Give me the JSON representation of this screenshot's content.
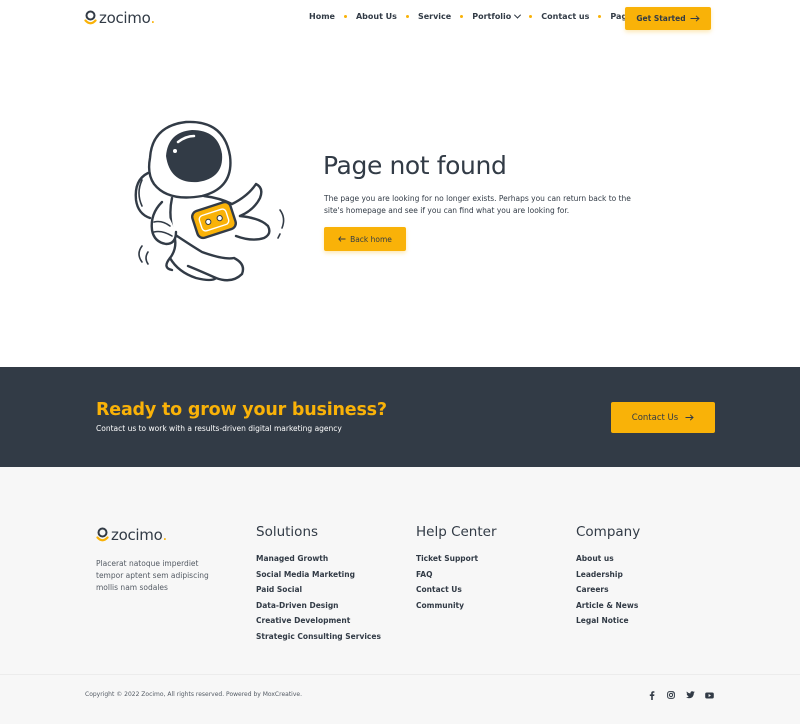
{
  "brand": {
    "name": "zocimo",
    "dot": ".",
    "accent": "#f9b208",
    "dark": "#323b46"
  },
  "nav": {
    "items": [
      {
        "label": "Home"
      },
      {
        "label": "About Us"
      },
      {
        "label": "Service"
      },
      {
        "label": "Portfolio"
      },
      {
        "label": "Contact us"
      },
      {
        "label": "Page"
      }
    ],
    "cta_label": "Get Started",
    "cta_icon": "arrow-right-icon"
  },
  "not_found": {
    "title": "Page not found",
    "text": "The page you are looking for no longer exists. Perhaps you can return back to the site's homepage and see if you can find what you are looking for.",
    "button_label": "Back home",
    "button_icon": "arrow-left-icon"
  },
  "cta": {
    "title": "Ready to grow your business?",
    "subtitle": "Contact us to work with a results-driven digital marketing agency",
    "button_label": "Contact Us",
    "button_icon": "arrow-right-icon"
  },
  "footer": {
    "description": "Placerat natoque imperdiet tempor aptent sem adipiscing mollis nam sodales",
    "columns": [
      {
        "title": "Solutions",
        "links": [
          "Managed Growth",
          "Social Media Marketing",
          "Paid Social",
          "Data-Driven Design",
          "Creative Development",
          "Strategic Consulting Services"
        ]
      },
      {
        "title": "Help Center",
        "links": [
          "Ticket Support",
          "FAQ",
          "Contact Us",
          "Community"
        ]
      },
      {
        "title": "Company",
        "links": [
          "About us",
          "Leadership",
          "Careers",
          "Article & News",
          "Legal Notice"
        ]
      }
    ],
    "copyright": "Copyright © 2022 Zocimo, All rights reserved. Powered by MoxCreative.",
    "socials": [
      "facebook-icon",
      "instagram-icon",
      "twitter-icon",
      "youtube-icon"
    ]
  }
}
